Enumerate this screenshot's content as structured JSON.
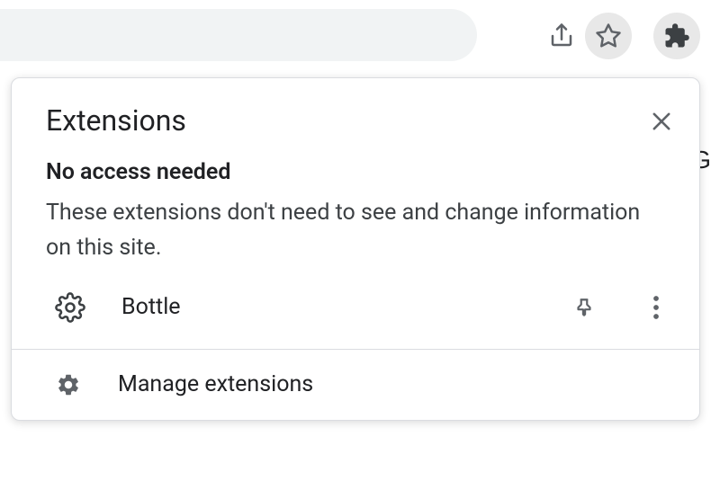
{
  "toolbar": {
    "share_icon": "share",
    "star_icon": "star",
    "extensions_icon": "puzzle"
  },
  "popup": {
    "title": "Extensions",
    "section_title": "No access needed",
    "section_desc": "These extensions don't need to see and change information on this site.",
    "extensions": [
      {
        "name": "Bottle",
        "icon": "gear"
      }
    ],
    "manage_label": "Manage extensions"
  },
  "background_letter": "G"
}
